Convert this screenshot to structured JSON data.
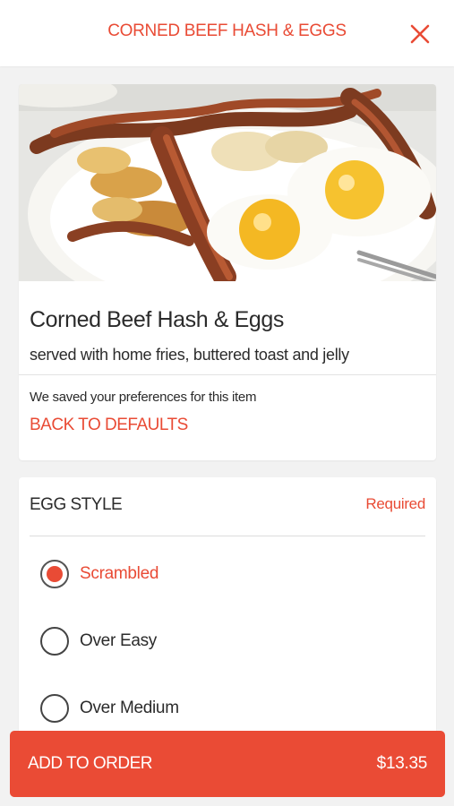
{
  "header": {
    "title": "CORNED BEEF HASH & EGGS",
    "close_icon": "close-icon"
  },
  "item": {
    "photo_icon": "food-photo",
    "name": "Corned Beef Hash & Eggs",
    "description": "served with home fries, buttered toast and jelly",
    "saved_text": "We saved your preferences for this item",
    "back_to_defaults": "BACK TO DEFAULTS"
  },
  "options": {
    "title": "EGG STYLE",
    "required_label": "Required",
    "choices": [
      {
        "label": "Scrambled",
        "selected": true
      },
      {
        "label": "Over Easy",
        "selected": false
      },
      {
        "label": "Over Medium",
        "selected": false
      }
    ]
  },
  "footer": {
    "add_label": "ADD TO ORDER",
    "price": "$13.35"
  },
  "colors": {
    "accent": "#e94b35",
    "background": "#f2f2f2",
    "text": "#2b2b2b"
  }
}
